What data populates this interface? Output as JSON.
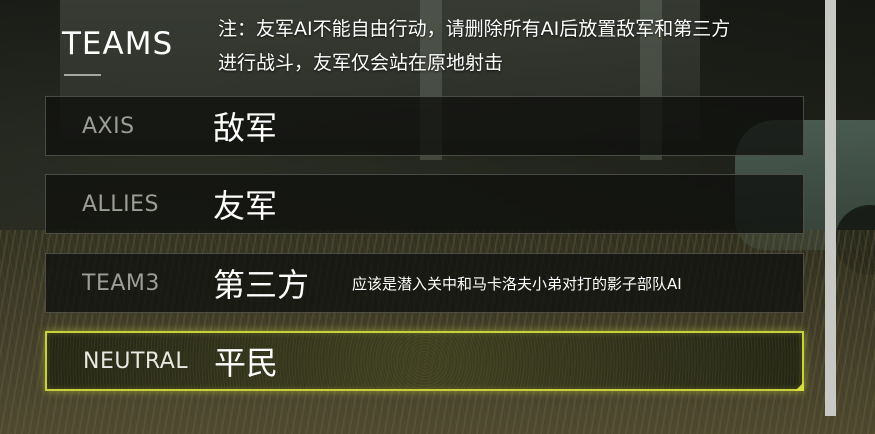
{
  "panel": {
    "title": "TEAMS",
    "note_lines": [
      "注：友军AI不能自由行动，请删除所有AI后放置敌军和第三方",
      "进行战斗，友军仅会站在原地射击"
    ]
  },
  "teams": [
    {
      "tag": "AXIS",
      "name": "敌军",
      "description": ""
    },
    {
      "tag": "ALLIES",
      "name": "友军",
      "description": ""
    },
    {
      "tag": "TEAM3",
      "name": "第三方",
      "description": "应该是潜入关中和马卡洛夫小弟对打的影子部队AI"
    },
    {
      "tag": "NEUTRAL",
      "name": "平民",
      "description": ""
    }
  ],
  "selected_team": "NEUTRAL",
  "colors": {
    "accent": "#c9d13a",
    "text": "#ffffff",
    "tag_text": "#9b9d96"
  }
}
